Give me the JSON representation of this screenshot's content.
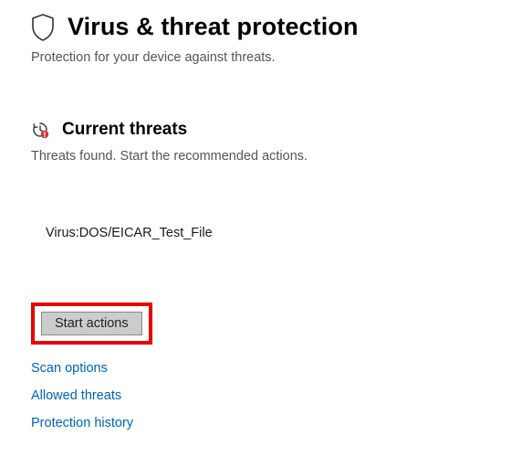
{
  "header": {
    "title": "Virus & threat protection",
    "subtitle": "Protection for your device against threats."
  },
  "section": {
    "title": "Current threats",
    "desc": "Threats found. Start the recommended actions."
  },
  "threat": {
    "name": "Virus:DOS/EICAR_Test_File"
  },
  "action_button": {
    "label": "Start actions"
  },
  "links": {
    "scan_options": "Scan options",
    "allowed_threats": "Allowed threats",
    "protection_history": "Protection history"
  }
}
